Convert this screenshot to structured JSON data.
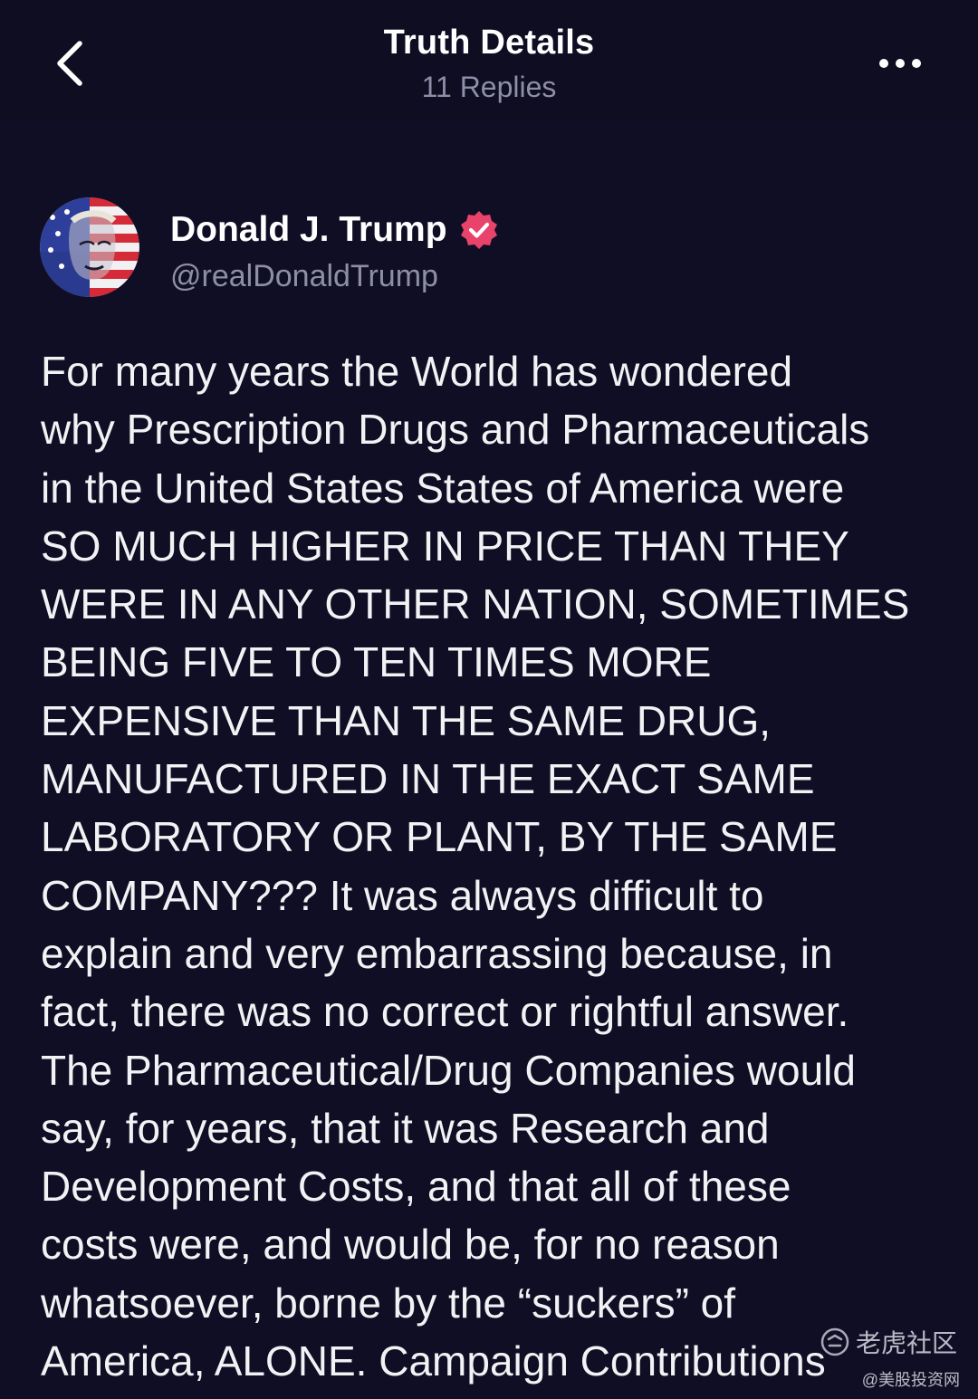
{
  "header": {
    "title": "Truth Details",
    "replies": "11 Replies"
  },
  "author": {
    "name": "Donald J. Trump",
    "handle": "@realDonaldTrump"
  },
  "post": {
    "lines": [
      "For many years the World has wondered",
      "why Prescription Drugs and Pharmaceuticals",
      "in the United States States of America were",
      "SO MUCH HIGHER IN PRICE THAN THEY",
      "WERE IN ANY OTHER NATION, SOMETIMES",
      "BEING FIVE TO TEN TIMES MORE",
      "EXPENSIVE THAN THE SAME DRUG,",
      "MANUFACTURED IN THE EXACT SAME",
      "LABORATORY OR PLANT, BY THE SAME",
      "COMPANY??? It was always difficult to",
      "explain and very embarrassing because, in",
      "fact, there was no correct or rightful answer.",
      "The Pharmaceutical/Drug Companies would",
      "say, for years, that it was Research and",
      "Development Costs, and that all of these",
      "costs were, and would be, for no reason",
      "whatsoever, borne by the “suckers” of",
      "America, ALONE. Campaign Contributions"
    ]
  },
  "watermarks": {
    "tiger": "老虎社区",
    "site": "@美股投资网"
  },
  "colors": {
    "background": "#0f0e24",
    "verified_badge": "#e8436b",
    "secondary_text": "#8e8ea8"
  },
  "icons": {
    "back": "chevron-left-icon",
    "more": "more-horizontal-icon",
    "verified": "verified-badge-icon"
  }
}
